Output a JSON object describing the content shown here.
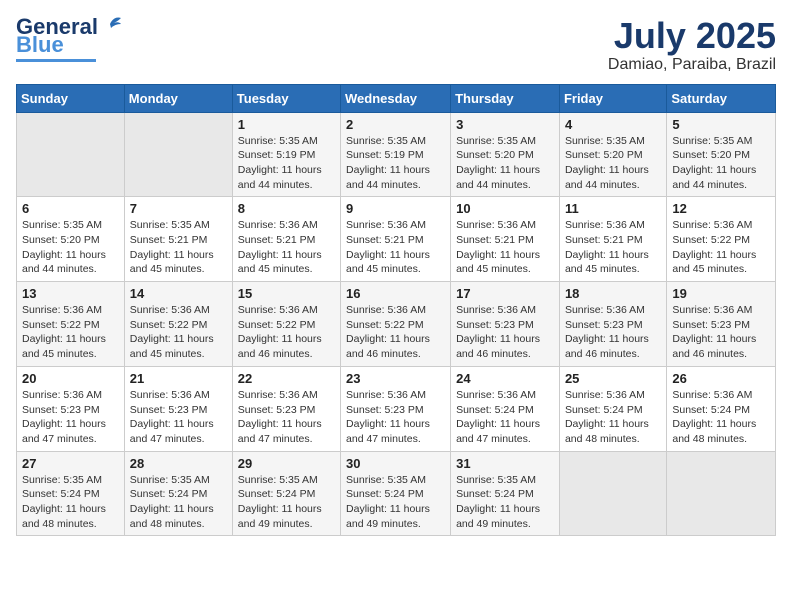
{
  "header": {
    "logo_line1": "General",
    "logo_line2": "Blue",
    "month": "July 2025",
    "location": "Damiao, Paraiba, Brazil"
  },
  "weekdays": [
    "Sunday",
    "Monday",
    "Tuesday",
    "Wednesday",
    "Thursday",
    "Friday",
    "Saturday"
  ],
  "weeks": [
    [
      {
        "day": "",
        "info": ""
      },
      {
        "day": "",
        "info": ""
      },
      {
        "day": "1",
        "info": "Sunrise: 5:35 AM\nSunset: 5:19 PM\nDaylight: 11 hours and 44 minutes."
      },
      {
        "day": "2",
        "info": "Sunrise: 5:35 AM\nSunset: 5:19 PM\nDaylight: 11 hours and 44 minutes."
      },
      {
        "day": "3",
        "info": "Sunrise: 5:35 AM\nSunset: 5:20 PM\nDaylight: 11 hours and 44 minutes."
      },
      {
        "day": "4",
        "info": "Sunrise: 5:35 AM\nSunset: 5:20 PM\nDaylight: 11 hours and 44 minutes."
      },
      {
        "day": "5",
        "info": "Sunrise: 5:35 AM\nSunset: 5:20 PM\nDaylight: 11 hours and 44 minutes."
      }
    ],
    [
      {
        "day": "6",
        "info": "Sunrise: 5:35 AM\nSunset: 5:20 PM\nDaylight: 11 hours and 44 minutes."
      },
      {
        "day": "7",
        "info": "Sunrise: 5:35 AM\nSunset: 5:21 PM\nDaylight: 11 hours and 45 minutes."
      },
      {
        "day": "8",
        "info": "Sunrise: 5:36 AM\nSunset: 5:21 PM\nDaylight: 11 hours and 45 minutes."
      },
      {
        "day": "9",
        "info": "Sunrise: 5:36 AM\nSunset: 5:21 PM\nDaylight: 11 hours and 45 minutes."
      },
      {
        "day": "10",
        "info": "Sunrise: 5:36 AM\nSunset: 5:21 PM\nDaylight: 11 hours and 45 minutes."
      },
      {
        "day": "11",
        "info": "Sunrise: 5:36 AM\nSunset: 5:21 PM\nDaylight: 11 hours and 45 minutes."
      },
      {
        "day": "12",
        "info": "Sunrise: 5:36 AM\nSunset: 5:22 PM\nDaylight: 11 hours and 45 minutes."
      }
    ],
    [
      {
        "day": "13",
        "info": "Sunrise: 5:36 AM\nSunset: 5:22 PM\nDaylight: 11 hours and 45 minutes."
      },
      {
        "day": "14",
        "info": "Sunrise: 5:36 AM\nSunset: 5:22 PM\nDaylight: 11 hours and 45 minutes."
      },
      {
        "day": "15",
        "info": "Sunrise: 5:36 AM\nSunset: 5:22 PM\nDaylight: 11 hours and 46 minutes."
      },
      {
        "day": "16",
        "info": "Sunrise: 5:36 AM\nSunset: 5:22 PM\nDaylight: 11 hours and 46 minutes."
      },
      {
        "day": "17",
        "info": "Sunrise: 5:36 AM\nSunset: 5:23 PM\nDaylight: 11 hours and 46 minutes."
      },
      {
        "day": "18",
        "info": "Sunrise: 5:36 AM\nSunset: 5:23 PM\nDaylight: 11 hours and 46 minutes."
      },
      {
        "day": "19",
        "info": "Sunrise: 5:36 AM\nSunset: 5:23 PM\nDaylight: 11 hours and 46 minutes."
      }
    ],
    [
      {
        "day": "20",
        "info": "Sunrise: 5:36 AM\nSunset: 5:23 PM\nDaylight: 11 hours and 47 minutes."
      },
      {
        "day": "21",
        "info": "Sunrise: 5:36 AM\nSunset: 5:23 PM\nDaylight: 11 hours and 47 minutes."
      },
      {
        "day": "22",
        "info": "Sunrise: 5:36 AM\nSunset: 5:23 PM\nDaylight: 11 hours and 47 minutes."
      },
      {
        "day": "23",
        "info": "Sunrise: 5:36 AM\nSunset: 5:23 PM\nDaylight: 11 hours and 47 minutes."
      },
      {
        "day": "24",
        "info": "Sunrise: 5:36 AM\nSunset: 5:24 PM\nDaylight: 11 hours and 47 minutes."
      },
      {
        "day": "25",
        "info": "Sunrise: 5:36 AM\nSunset: 5:24 PM\nDaylight: 11 hours and 48 minutes."
      },
      {
        "day": "26",
        "info": "Sunrise: 5:36 AM\nSunset: 5:24 PM\nDaylight: 11 hours and 48 minutes."
      }
    ],
    [
      {
        "day": "27",
        "info": "Sunrise: 5:35 AM\nSunset: 5:24 PM\nDaylight: 11 hours and 48 minutes."
      },
      {
        "day": "28",
        "info": "Sunrise: 5:35 AM\nSunset: 5:24 PM\nDaylight: 11 hours and 48 minutes."
      },
      {
        "day": "29",
        "info": "Sunrise: 5:35 AM\nSunset: 5:24 PM\nDaylight: 11 hours and 49 minutes."
      },
      {
        "day": "30",
        "info": "Sunrise: 5:35 AM\nSunset: 5:24 PM\nDaylight: 11 hours and 49 minutes."
      },
      {
        "day": "31",
        "info": "Sunrise: 5:35 AM\nSunset: 5:24 PM\nDaylight: 11 hours and 49 minutes."
      },
      {
        "day": "",
        "info": ""
      },
      {
        "day": "",
        "info": ""
      }
    ]
  ]
}
